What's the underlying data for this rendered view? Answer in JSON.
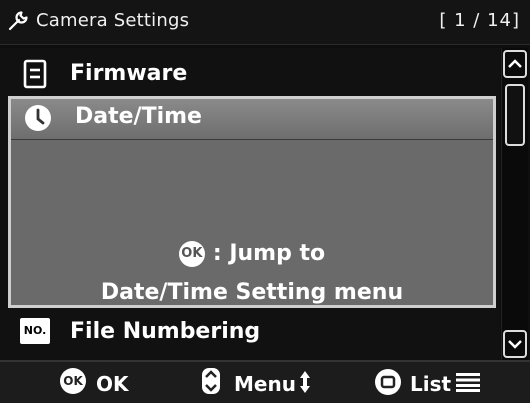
{
  "header": {
    "title": "Camera Settings",
    "page_indicator": "[ 1 / 14]",
    "icon": "wrench-icon"
  },
  "menu": {
    "items": [
      {
        "label": "Firmware",
        "icon": "document-icon"
      },
      {
        "label": "Date/Time",
        "icon": "clock-icon",
        "selected": true
      },
      {
        "label": "File Numbering",
        "icon": "no-icon"
      }
    ],
    "selected_info": {
      "ok_text": "OK",
      "line1": ": Jump to",
      "line2": "Date/Time Setting menu"
    }
  },
  "no_badge": "NO.",
  "footer": {
    "ok_icon_text": "OK",
    "ok_label": "OK",
    "menu_label": "Menu",
    "list_label": "List"
  },
  "colors": {
    "background": "#0e0e0e",
    "selected_bg": "#6a6a6a",
    "text": "#ffffff"
  }
}
